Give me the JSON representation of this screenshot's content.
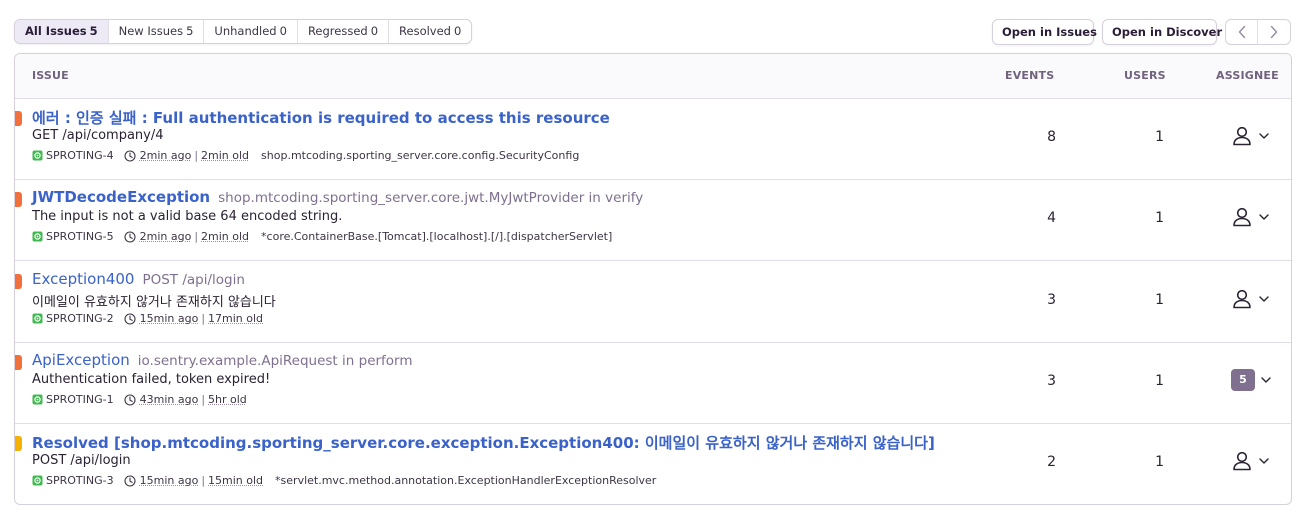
{
  "tabs": [
    {
      "label": "All Issues",
      "count": "5",
      "active": true
    },
    {
      "label": "New Issues",
      "count": "5",
      "active": false
    },
    {
      "label": "Unhandled",
      "count": "0",
      "active": false
    },
    {
      "label": "Regressed",
      "count": "0",
      "active": false
    },
    {
      "label": "Resolved",
      "count": "0",
      "active": false
    }
  ],
  "actions": {
    "open_in_issues": "Open in Issues",
    "open_in_discover": "Open in Discover"
  },
  "table": {
    "headers": {
      "issue": "ISSUE",
      "events": "EVENTS",
      "users": "USERS",
      "assignee": "ASSIGNEE"
    },
    "rows": [
      {
        "title": "에러 : 인증 실패 : Full authentication is required to access this resource",
        "location": "",
        "message": "GET /api/company/4",
        "short_id": "SPROTING-4",
        "last_seen": "2min ago",
        "first_seen": "2min old",
        "culprit": "shop.mtcoding.sporting_server.core.config.SecurityConfig",
        "events": "8",
        "users": "1",
        "assignee": "",
        "level_color": "#f2703c"
      },
      {
        "title": "JWTDecodeException",
        "location": "shop.mtcoding.sporting_server.core.jwt.MyJwtProvider in verify",
        "message": "The input is not a valid base 64 encoded string.",
        "short_id": "SPROTING-5",
        "last_seen": "2min ago",
        "first_seen": "2min old",
        "culprit": "*core.ContainerBase.[Tomcat].[localhost].[/].[dispatcherServlet]",
        "events": "4",
        "users": "1",
        "assignee": "",
        "level_color": "#f2703c"
      },
      {
        "title": "Exception400",
        "location": "POST /api/login",
        "message": "이메일이 유효하지 않거나 존재하지 않습니다",
        "short_id": "SPROTING-2",
        "last_seen": "15min ago",
        "first_seen": "17min old",
        "culprit": "",
        "events": "3",
        "users": "1",
        "assignee": "",
        "level_color": "#f2703c"
      },
      {
        "title": "ApiException",
        "location": "io.sentry.example.ApiRequest in perform",
        "message": "Authentication failed, token expired!",
        "short_id": "SPROTING-1",
        "last_seen": "43min ago",
        "first_seen": "5hr old",
        "culprit": "",
        "events": "3",
        "users": "1",
        "assignee": "5",
        "level_color": "#f2703c"
      },
      {
        "title": "Resolved [shop.mtcoding.sporting_server.core.exception.Exception400: 이메일이 유효하지 않거나 존재하지 않습니다]",
        "location": "",
        "message": "POST /api/login",
        "short_id": "SPROTING-3",
        "last_seen": "15min ago",
        "first_seen": "15min old",
        "culprit": "*servlet.mvc.method.annotation.ExceptionHandlerExceptionResolver",
        "events": "2",
        "users": "1",
        "assignee": "",
        "level_color": "#f5b000"
      }
    ]
  },
  "colors": {
    "link": "#3a62c9",
    "error": "#f2703c",
    "warning": "#f5b000",
    "project": "#3fb950"
  },
  "icons": {
    "project": "project-icon",
    "clock": "clock-icon",
    "user": "user-icon",
    "chevron": "chevron-down-icon",
    "prev": "chevron-left-icon",
    "next": "chevron-right-icon"
  }
}
